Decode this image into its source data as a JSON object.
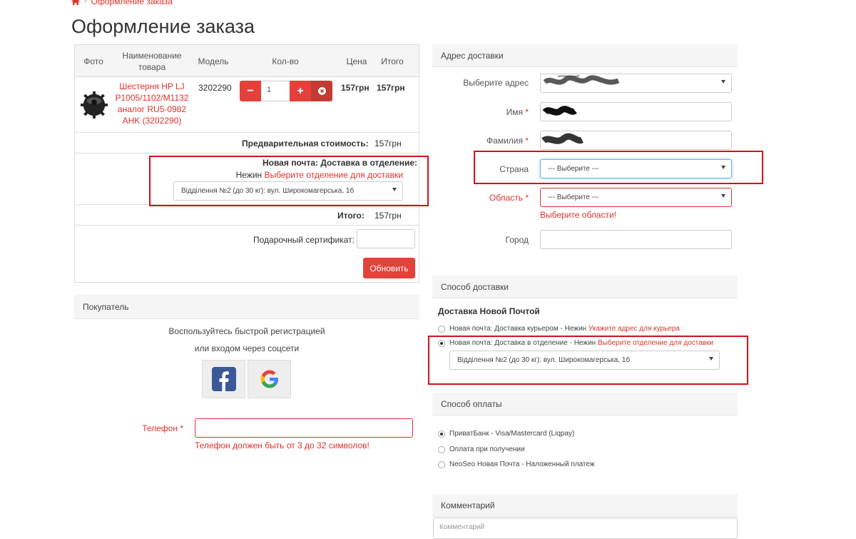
{
  "breadcrumb": {
    "current": "Оформление заказа"
  },
  "page_title": "Оформление заказа",
  "cart": {
    "headers": {
      "photo": "Фото",
      "name": "Наименование товара",
      "model": "Модель",
      "qty": "Кол-во",
      "price": "Цена",
      "total": "Итого"
    },
    "item": {
      "name": "Шестерня HP LJ P1005/1102/M1132 аналог RU5-0982 AHK (3202290)",
      "model": "3202290",
      "qty": "1",
      "price": "157грн",
      "total": "157грн"
    },
    "subtotal_label": "Предварительная стоимость:",
    "subtotal_value": "157грн",
    "shipping_title": "Новая почта: Доставка в отделение:",
    "shipping_city": "Нежин",
    "shipping_link": "Выберите отделение для доставки",
    "shipping_select": "Відділення №2 (до 30 кг): вул. Широкомагерська, 1б",
    "total_label": "Итого:",
    "total_value": "157грн",
    "gift_label": "Подарочный сертификат:",
    "update_button": "Обновить"
  },
  "buyer": {
    "header": "Покупатель",
    "line1": "Воспользуйтесь быстрой регистрацией",
    "line2": "или входом через соцсети",
    "phone_label": "Телефон",
    "required_mark": "*",
    "phone_error": "Телефон должен быть от 3 до 32 символов!"
  },
  "address": {
    "header": "Адрес доставки",
    "select_label": "Выберите адрес",
    "first_name_label": "Имя",
    "last_name_label": "Фамилия",
    "country_label": "Страна",
    "country_value": "--- Выберите ---",
    "region_label": "Область",
    "region_value": "--- Выберите ---",
    "region_error": "Выберите области!",
    "city_label": "Город"
  },
  "delivery": {
    "header": "Способ доставки",
    "group_title": "Доставка Новой Почтой",
    "option1_text": "Новая почта: Доставка курьером - Нежин",
    "option1_link": "Укажите адрес для курьера",
    "option2_text": "Новая почта: Доставка в отделение - Нежин",
    "option2_link": "Выберите отделение для доставки",
    "option2_select": "Відділення №2 (до 30 кг): вул. Широкомагерська, 1б",
    "selected_option": 2
  },
  "payment": {
    "header": "Способ оплаты",
    "options": [
      "ПриватБанк - Visa/Mastercard (Liqpay)",
      "Оплата при получении",
      "NeoSeo Новая Почта - Наложенный платеж"
    ],
    "selected_option": 1
  },
  "comment": {
    "header": "Комментарий",
    "placeholder": "Комментарий"
  },
  "colors": {
    "accent": "#e0322b",
    "button": "#e5403a",
    "highlight_box": "#d0141a",
    "panel_bg": "#f5f5f5"
  }
}
